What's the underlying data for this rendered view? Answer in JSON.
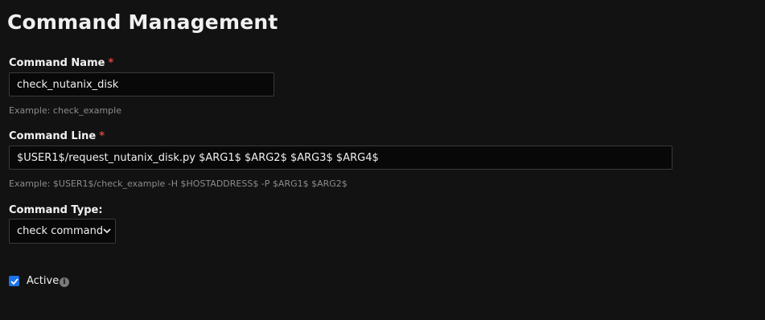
{
  "page": {
    "title": "Command Management"
  },
  "form": {
    "command_name": {
      "label": "Command Name",
      "required_marker": "*",
      "value": "check_nutanix_disk",
      "help": "Example: check_example"
    },
    "command_line": {
      "label": "Command Line",
      "required_marker": "*",
      "value": "$USER1$/request_nutanix_disk.py $ARG1$ $ARG2$ $ARG3$ $ARG4$",
      "help": "Example: $USER1$/check_example -H $HOSTADDRESS$ -P $ARG1$ $ARG2$"
    },
    "command_type": {
      "label": "Command Type:",
      "selected": "check command"
    },
    "active": {
      "label": "Active",
      "checked": true,
      "info_icon": "info-icon"
    }
  },
  "colors": {
    "background": "#121212",
    "required": "#e0443d",
    "checkbox_accent": "#1a73e8"
  }
}
